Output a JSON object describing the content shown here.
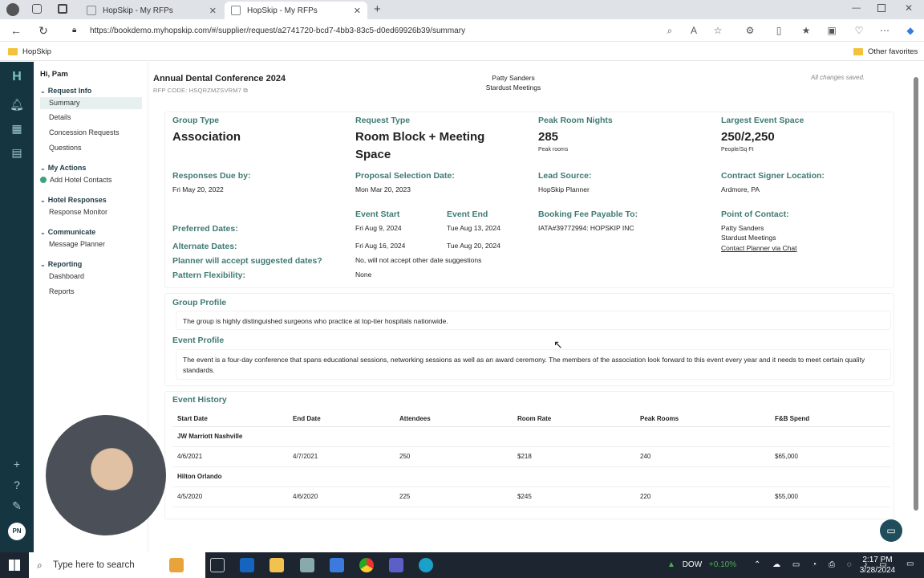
{
  "browser": {
    "tabs": [
      {
        "title": "HopSkip - My RFPs",
        "active": false
      },
      {
        "title": "HopSkip - My RFPs",
        "active": true
      }
    ],
    "url": "https://bookdemo.myhopskip.com/#/supplier/request/a2741720-bcd7-4bb3-83c5-d0ed69926b39/summary",
    "bookmarks": {
      "left": "HopSkip",
      "right": "Other favorites"
    }
  },
  "sidebar": {
    "greeting": "Hi, Pam",
    "request_info": "Request Info",
    "summary": "Summary",
    "details": "Details",
    "concessions": "Concession Requests",
    "questions": "Questions",
    "my_actions": "My Actions",
    "add_contacts": "Add Hotel Contacts",
    "hotel_responses": "Hotel Responses",
    "response_monitor": "Response Monitor",
    "communicate": "Communicate",
    "message_planner": "Message Planner",
    "reporting": "Reporting",
    "dashboard": "Dashboard",
    "reports": "Reports"
  },
  "rail": {
    "avatar_initials": "PN"
  },
  "header": {
    "title": "Annual Dental Conference 2024",
    "rfp_code": "RFP CODE: HSQRZMZSVRM7",
    "contact_name": "Patty Sanders",
    "contact_company": "Stardust Meetings",
    "saved_status": "All changes saved."
  },
  "summary": {
    "group_type_label": "Group Type",
    "group_type": "Association",
    "request_type_label": "Request Type",
    "request_type_line1": "Room Block + Meeting",
    "request_type_line2": "Space",
    "peak_nights_label": "Peak Room Nights",
    "peak_nights": "285",
    "peak_nights_sub": "Peak rooms",
    "largest_space_label": "Largest Event Space",
    "largest_space": "250/2,250",
    "largest_space_sub": "People/Sq Ft",
    "responses_due_label": "Responses Due by:",
    "responses_due": "Fri May 20, 2022",
    "proposal_date_label": "Proposal Selection Date:",
    "proposal_date": "Mon Mar 20, 2023",
    "lead_source_label": "Lead Source:",
    "lead_source": "HopSkip Planner",
    "signer_location_label": "Contract Signer Location:",
    "signer_location": "Ardmore, PA",
    "event_start_label": "Event Start",
    "event_end_label": "Event End",
    "booking_fee_label": "Booking Fee Payable To:",
    "booking_fee": "IATA#39772994: HOPSKIP INC",
    "poc_label": "Point of Contact:",
    "poc_name": "Patty Sanders",
    "poc_company": "Stardust Meetings",
    "poc_link": "Contact Planner via Chat",
    "preferred_label": "Preferred Dates:",
    "preferred_start": "Fri Aug 9, 2024",
    "preferred_end": "Tue Aug 13, 2024",
    "alternate_label": "Alternate Dates:",
    "alternate_start": "Fri Aug 16, 2024",
    "alternate_end": "Tue Aug 20, 2024",
    "accept_label": "Planner will accept suggested dates?",
    "accept_value": "No, will not accept other date suggestions",
    "pattern_label": "Pattern Flexibility:",
    "pattern_value": "None"
  },
  "group_profile": {
    "label": "Group Profile",
    "text": "The group is highly distinguished surgeons who practice at top-tier hospitals nationwide."
  },
  "event_profile": {
    "label": "Event Profile",
    "text": "The event is a four-day conference that spans educational sessions, networking sessions as well as an award ceremony. The members of the association look forward to this event every year and it needs to meet certain quality standards."
  },
  "event_history": {
    "label": "Event History",
    "columns": [
      "Start Date",
      "End Date",
      "Attendees",
      "Room Rate",
      "Peak Rooms",
      "F&B Spend"
    ],
    "hotels": [
      {
        "name": "JW Marriott Nashville",
        "row": [
          "4/6/2021",
          "4/7/2021",
          "250",
          "$218",
          "240",
          "$65,000"
        ]
      },
      {
        "name": "Hilton Orlando",
        "row": [
          "4/5/2020",
          "4/6/2020",
          "225",
          "$245",
          "220",
          "$55,000"
        ]
      }
    ]
  },
  "taskbar": {
    "search_placeholder": "Type here to search",
    "stock_name": "DOW",
    "stock_change": "+0.10%",
    "time": "2:17 PM",
    "date": "3/28/2024"
  }
}
